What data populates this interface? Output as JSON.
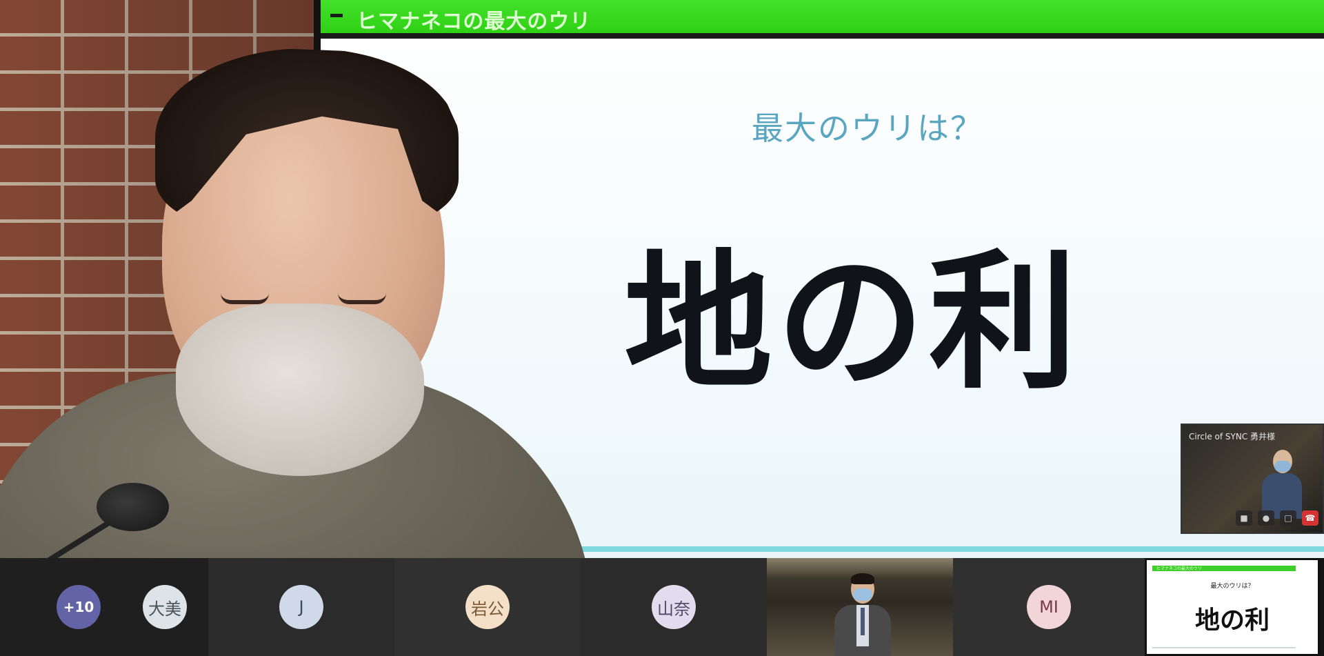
{
  "main_video": {
    "slide": {
      "header_title": "ヒマナネコの最大のウリ",
      "subtitle": "最大のウリは？",
      "big_text": "地の利"
    },
    "pip": {
      "caption": "Circle of SYNC 勇井様"
    }
  },
  "participants": {
    "overflow_count": "+10",
    "avatars": [
      {
        "initials": "大美",
        "bg": "#dde3e6",
        "fg": "#4a5358"
      },
      {
        "initials": "J",
        "bg": "#cfd9ea",
        "fg": "#3a4a66"
      },
      {
        "initials": "岩公",
        "bg": "#f4e0c8",
        "fg": "#7a5a35"
      },
      {
        "initials": "山奈",
        "bg": "#e1dcee",
        "fg": "#4e4a66"
      },
      {
        "initials": "MI",
        "bg": "#f1d5d8",
        "fg": "#7a3a44"
      }
    ],
    "shared_slide_thumb": {
      "header_text": "ヒマナネコの最大のウリ",
      "subtitle": "最大のウリは？",
      "big_text": "地の利"
    }
  },
  "colors": {
    "overflow_badge": "#6264a7",
    "slide_header": "#43e02a"
  }
}
